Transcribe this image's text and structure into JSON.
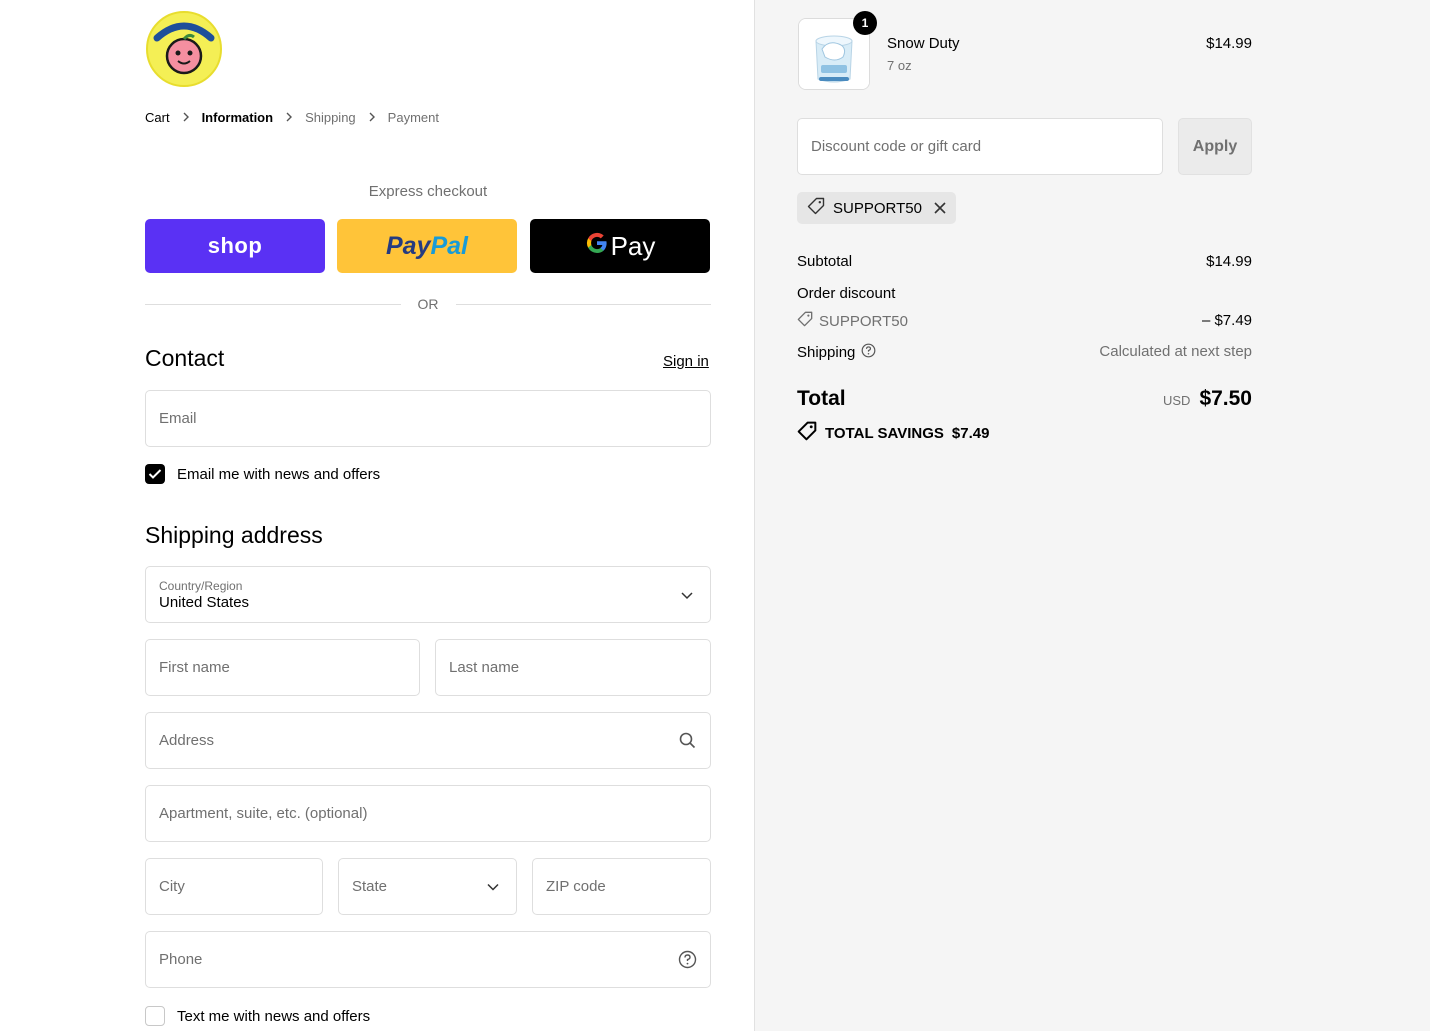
{
  "breadcrumb": {
    "items": [
      {
        "label": "Cart",
        "state": "link"
      },
      {
        "label": "Information",
        "state": "active"
      },
      {
        "label": "Shipping",
        "state": "muted"
      },
      {
        "label": "Payment",
        "state": "muted"
      }
    ]
  },
  "express": {
    "title": "Express checkout",
    "shop_label": "shop",
    "paypal_label_1": "Pay",
    "paypal_label_2": "Pal",
    "gpay_label": "Pay",
    "or_label": "OR"
  },
  "contact": {
    "heading": "Contact",
    "signin_label": "Sign in",
    "email_placeholder": "Email",
    "news_checkbox_label": "Email me with news and offers",
    "news_checked": true
  },
  "shipping": {
    "heading": "Shipping address",
    "country_label": "Country/Region",
    "country_value": "United States",
    "first_name_placeholder": "First name",
    "last_name_placeholder": "Last name",
    "address_placeholder": "Address",
    "apartment_placeholder": "Apartment, suite, etc. (optional)",
    "city_placeholder": "City",
    "state_placeholder": "State",
    "zip_placeholder": "ZIP code",
    "phone_placeholder": "Phone",
    "sms_checkbox_label": "Text me with news and offers",
    "sms_checked": false
  },
  "order": {
    "quantity": "1",
    "product_name": "Snow Duty",
    "product_variant": "7 oz",
    "product_price": "$14.99",
    "discount_placeholder": "Discount code or gift card",
    "apply_label": "Apply",
    "applied_code": "SUPPORT50",
    "subtotal_label": "Subtotal",
    "subtotal_value": "$14.99",
    "order_discount_label": "Order discount",
    "order_discount_code": "SUPPORT50",
    "order_discount_value": "– $7.49",
    "shipping_label": "Shipping",
    "shipping_value": "Calculated at next step",
    "total_label": "Total",
    "total_currency": "USD",
    "total_value": "$7.50",
    "savings_label": "TOTAL SAVINGS",
    "savings_value": "$7.49"
  },
  "colors": {
    "shop": "#5a31f4",
    "paypal": "#ffc439",
    "gpay": "#000000",
    "summary_bg": "#f5f5f5"
  }
}
